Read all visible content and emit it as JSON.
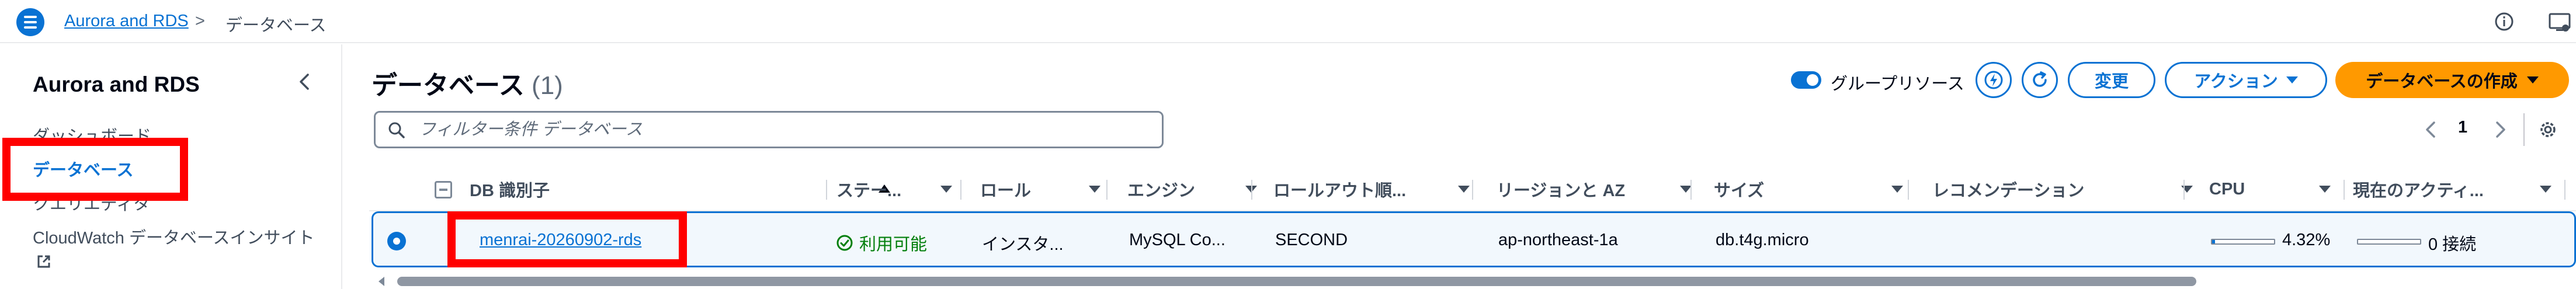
{
  "topbar": {
    "breadcrumb_link": "Aurora and RDS",
    "breadcrumb_separator": ">",
    "breadcrumb_current": "データベース"
  },
  "sidenav": {
    "title": "Aurora and RDS",
    "items": [
      {
        "label": "ダッシュボード",
        "active": false
      },
      {
        "label": "データベース",
        "active": true
      },
      {
        "label": "クエリエディタ",
        "active": false
      },
      {
        "label": "CloudWatch データベースインサイト",
        "active": false,
        "external": true
      }
    ]
  },
  "header": {
    "title": "データベース",
    "count": "(1)",
    "group_toggle_label": "グループリソース",
    "group_toggle_on": true,
    "modify_label": "変更",
    "actions_label": "アクション",
    "create_label": "データベースの作成"
  },
  "filter": {
    "placeholder": "フィルター条件 データベース",
    "value": ""
  },
  "pagination": {
    "current_page": "1"
  },
  "table": {
    "columns": [
      "DB 識別子",
      "ステー...",
      "ロール",
      "エンジン",
      "ロールアウト順...",
      "リージョンと AZ",
      "サイズ",
      "レコメンデーション",
      "CPU",
      "現在のアクティ..."
    ],
    "rows": [
      {
        "identifier": "menrai-20260902-rds",
        "status": "利用可能",
        "role": "インスタ...",
        "engine": "MySQL Co...",
        "rollout": "SECOND",
        "region_az": "ap-northeast-1a",
        "size": "db.t4g.micro",
        "recommendation": "",
        "cpu_text": "4.32%",
        "cpu_fraction": 0.0432,
        "activity_text": "0 接続",
        "activity_fraction": 0,
        "selected": true
      }
    ]
  },
  "colors": {
    "accent": "#0972d3",
    "primary_button": "#ff9900",
    "status_ok": "#037f0c",
    "highlight_box": "#ff0000"
  },
  "icons": [
    "menu-icon",
    "chevron-right-icon",
    "info-icon",
    "utilities-icon",
    "chevron-left-icon",
    "external-link-icon",
    "lightning-icon",
    "refresh-icon",
    "search-icon",
    "settings-icon",
    "status-ok-icon",
    "sort-icon"
  ]
}
